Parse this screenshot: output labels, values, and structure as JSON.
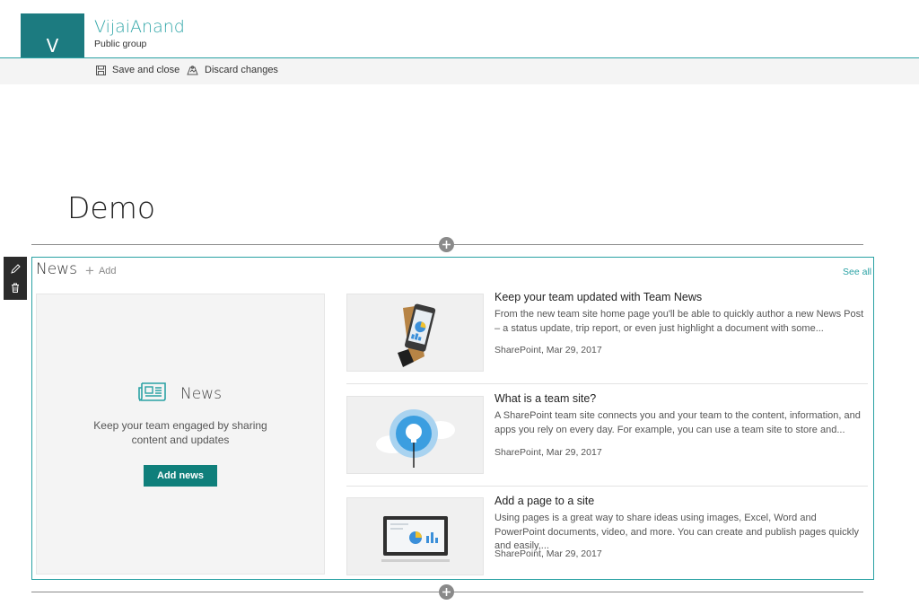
{
  "site": {
    "logo_letter": "V",
    "title": "VijaiAnand",
    "subtitle": "Public group"
  },
  "commandbar": {
    "save_label": "Save and close",
    "discard_label": "Discard changes"
  },
  "page": {
    "title": "Demo"
  },
  "webpart": {
    "title": "News",
    "add_label": "Add",
    "see_all_label": "See all",
    "placeholder": {
      "title": "News",
      "description": "Keep your team engaged by sharing content and updates",
      "button_label": "Add news"
    },
    "items": [
      {
        "title": "Keep your team updated with Team News",
        "description": "From the new team site home page you'll be able to quickly author a new News Post – a status update, trip report, or even just highlight a document with some...",
        "meta": "SharePoint, Mar 29, 2017",
        "thumb_icon": "phone-chart-icon"
      },
      {
        "title": "What is a team site?",
        "description": "A SharePoint team site connects you and your team to the content, information, and apps you rely on every day. For example, you can use a team site to store and...",
        "meta": "SharePoint, Mar 29, 2017",
        "thumb_icon": "lightbulb-cloud-icon"
      },
      {
        "title": "Add a page to a site",
        "description": "Using pages is a great way to share ideas using images, Excel, Word and PowerPoint documents, video, and more. You can create and publish pages quickly and easily,...",
        "meta": "SharePoint, Mar 29, 2017",
        "thumb_icon": "monitor-chart-icon"
      }
    ]
  },
  "colors": {
    "accent": "#2aa2a4",
    "logo_bg": "#1c7b80",
    "button_bg": "#0f7f7b"
  }
}
